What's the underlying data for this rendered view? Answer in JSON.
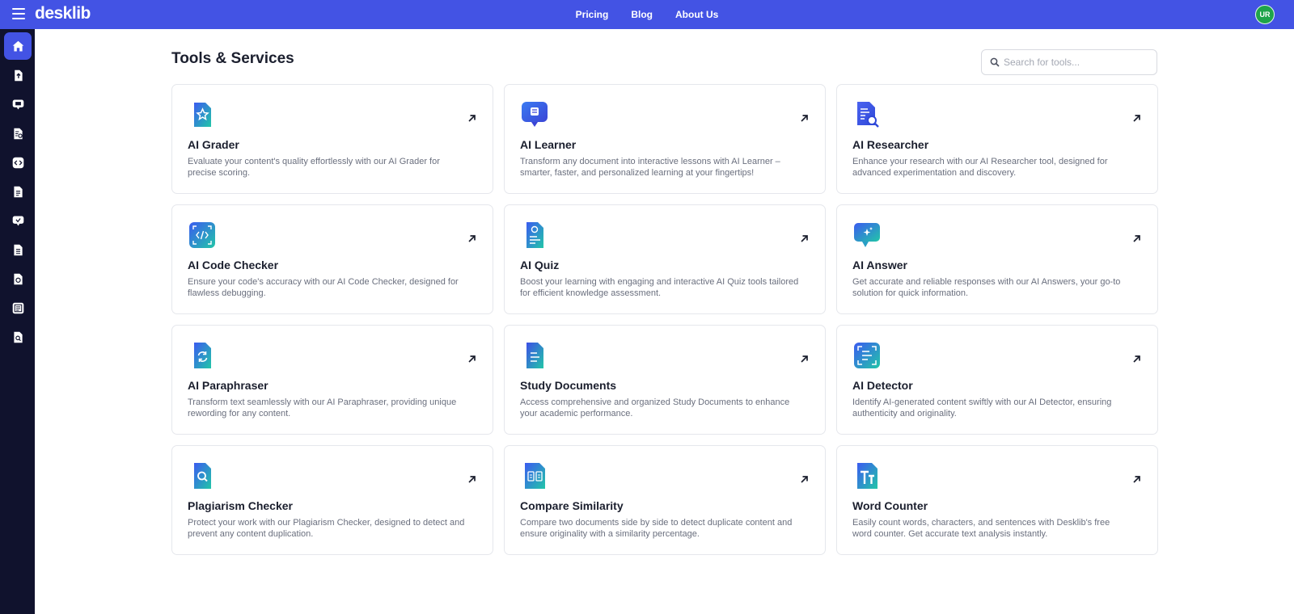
{
  "header": {
    "logo": "desklib",
    "nav": [
      "Pricing",
      "Blog",
      "About Us"
    ],
    "avatar_initials": "UR",
    "bg_color": "#4353e4"
  },
  "sidebar": {
    "items": [
      {
        "icon": "home-icon",
        "active": true
      },
      {
        "icon": "document-upload-icon"
      },
      {
        "icon": "chat-book-icon"
      },
      {
        "icon": "document-search-icon"
      },
      {
        "icon": "code-icon"
      },
      {
        "icon": "document-list-icon"
      },
      {
        "icon": "chat-heart-icon"
      },
      {
        "icon": "document-text-icon"
      },
      {
        "icon": "refresh-document-icon"
      },
      {
        "icon": "document-scan-icon"
      },
      {
        "icon": "document-magnify-icon"
      }
    ]
  },
  "main": {
    "title": "Tools & Services",
    "search_placeholder": "Search for tools...",
    "cards": [
      {
        "title": "AI Grader",
        "desc": "Evaluate your content's quality effortlessly with our AI Grader for precise scoring.",
        "icon": "star-document-icon"
      },
      {
        "title": "AI Learner",
        "desc": "Transform any document into interactive lessons with AI Learner – smarter, faster, and personalized learning at your fingertips!",
        "icon": "learner-chat-icon"
      },
      {
        "title": "AI Researcher",
        "desc": "Enhance your research with our AI Researcher tool, designed for advanced experimentation and discovery.",
        "icon": "research-document-icon"
      },
      {
        "title": "AI Code Checker",
        "desc": "Ensure your code's accuracy with our AI Code Checker, designed for flawless debugging.",
        "icon": "code-check-icon"
      },
      {
        "title": "AI Quiz",
        "desc": "Boost your learning with engaging and interactive AI Quiz tools tailored for efficient knowledge assessment.",
        "icon": "quiz-document-icon"
      },
      {
        "title": "AI Answer",
        "desc": "Get accurate and reliable responses with our AI Answers, your go-to solution for quick information.",
        "icon": "answer-chat-icon"
      },
      {
        "title": "AI Paraphraser",
        "desc": "Transform text seamlessly with our AI Paraphraser, providing unique rewording for any content.",
        "icon": "paraphrase-document-icon"
      },
      {
        "title": "Study Documents",
        "desc": "Access comprehensive and organized Study Documents to enhance your academic performance.",
        "icon": "study-document-icon"
      },
      {
        "title": "AI Detector",
        "desc": "Identify AI-generated content swiftly with our AI Detector, ensuring authenticity and originality.",
        "icon": "detector-scan-icon"
      },
      {
        "title": "Plagiarism Checker",
        "desc": "Protect your work with our Plagiarism Checker, designed to detect and prevent any content duplication.",
        "icon": "plagiarism-search-icon"
      },
      {
        "title": "Compare Similarity",
        "desc": "Compare two documents side by side to detect duplicate content and ensure originality with a similarity percentage.",
        "icon": "compare-book-icon"
      },
      {
        "title": "Word Counter",
        "desc": "Easily count words, characters, and sentences with Desklib's free word counter. Get accurate text analysis instantly.",
        "icon": "word-counter-icon"
      }
    ]
  }
}
